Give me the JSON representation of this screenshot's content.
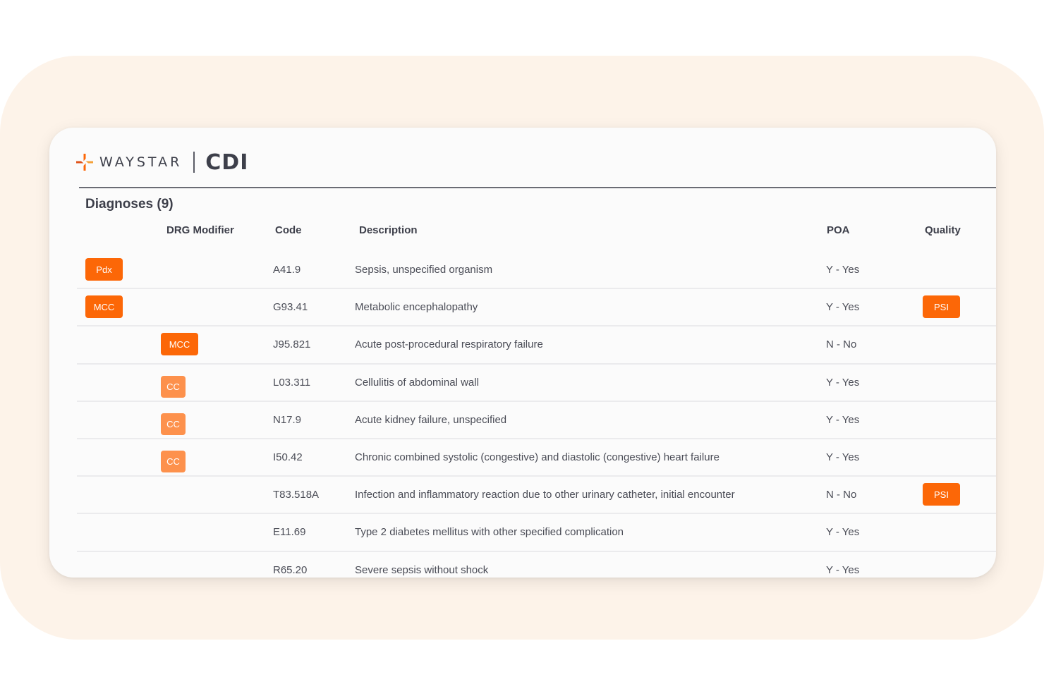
{
  "brand": {
    "company": "WAYSTAR",
    "product": "CDI",
    "logo_icon": "waystar-star-icon",
    "accent_color": "#fc6707",
    "accent_light_color": "#fd914c"
  },
  "section": {
    "title": "Diagnoses (9)"
  },
  "columns": {
    "drg_modifier": "DRG Modifier",
    "code": "Code",
    "description": "Description",
    "poa": "POA",
    "quality": "Quality"
  },
  "rows": [
    {
      "badge": "Pdx",
      "badge_col": "first",
      "badge_tone": "strong",
      "code": "A41.9",
      "description": "Sepsis, unspecified organism",
      "poa": "Y - Yes",
      "quality": ""
    },
    {
      "badge": "MCC",
      "badge_col": "first",
      "badge_tone": "strong",
      "code": "G93.41",
      "description": "Metabolic encephalopathy",
      "poa": "Y - Yes",
      "quality": "PSI"
    },
    {
      "badge": "MCC",
      "badge_col": "drg",
      "badge_tone": "strong",
      "code": "J95.821",
      "description": "Acute post-procedural respiratory failure",
      "poa": "N - No",
      "quality": ""
    },
    {
      "badge": "CC",
      "badge_col": "drg",
      "badge_tone": "light",
      "code": "L03.311",
      "description": "Cellulitis of abdominal wall",
      "poa": "Y - Yes",
      "quality": ""
    },
    {
      "badge": "CC",
      "badge_col": "drg",
      "badge_tone": "light",
      "code": "N17.9",
      "description": "Acute kidney failure, unspecified",
      "poa": "Y - Yes",
      "quality": ""
    },
    {
      "badge": "CC",
      "badge_col": "drg",
      "badge_tone": "light",
      "code": "I50.42",
      "description": "Chronic combined systolic (congestive) and diastolic (congestive) heart failure",
      "poa": "Y - Yes",
      "quality": ""
    },
    {
      "badge": "",
      "badge_col": "",
      "badge_tone": "",
      "code": "T83.518A",
      "description": "Infection and inflammatory reaction due to other urinary catheter, initial encounter",
      "poa": "N - No",
      "quality": "PSI"
    },
    {
      "badge": "",
      "badge_col": "",
      "badge_tone": "",
      "code": "E11.69",
      "description": "Type 2 diabetes mellitus with other specified complication",
      "poa": "Y - Yes",
      "quality": ""
    },
    {
      "badge": "",
      "badge_col": "",
      "badge_tone": "",
      "code": "R65.20",
      "description": "Severe sepsis without shock",
      "poa": "Y - Yes",
      "quality": ""
    }
  ]
}
